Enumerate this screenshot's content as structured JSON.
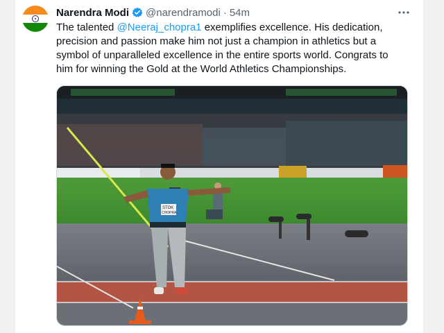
{
  "author": {
    "name": "Narendra Modi",
    "handle": "@narendramodi",
    "separator": "·",
    "time": "54m",
    "avatar_icon": "india-flag-avatar",
    "verified_icon": "verified-badge-icon"
  },
  "tweet": {
    "line1_pre": "The talented ",
    "mention": "@Neeraj_chopra1",
    "line1_post": " exemplifies excellence. His dedication,",
    "line2": "precision and passion make him not just a champion in athletics but a",
    "line3": "symbol of unparalleled excellence in the entire sports world. Congrats to",
    "line4": "him for winning the Gold at the World Athletics Championships."
  },
  "media": {
    "image_icon": "javelin-athlete-photo",
    "bib_line1": "STOK",
    "bib_line2": "CHOPRA"
  },
  "menu": {
    "icon": "more-options-icon",
    "glyph": "···"
  },
  "colors": {
    "link": "#1d9bf0",
    "verified": "#1d9bf0",
    "secondary_text": "#536471"
  }
}
